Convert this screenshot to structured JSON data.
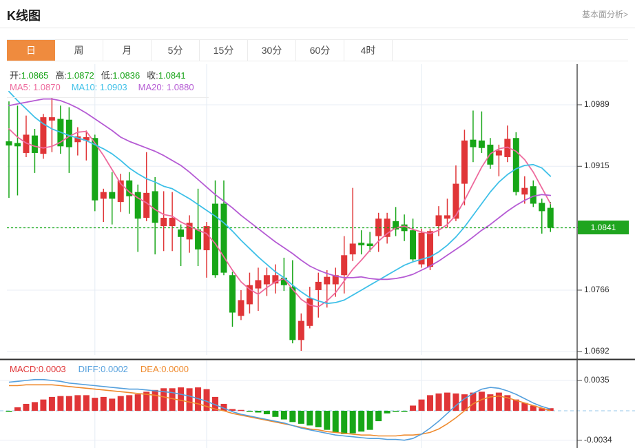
{
  "header": {
    "title": "K线图",
    "link": "基本面分析>"
  },
  "tabs": {
    "items": [
      "日",
      "周",
      "月",
      "5分",
      "15分",
      "30分",
      "60分",
      "4时"
    ],
    "active": "日"
  },
  "info": {
    "ohlc": [
      {
        "label": "开:",
        "value": "1.0865"
      },
      {
        "label": "高:",
        "value": "1.0872"
      },
      {
        "label": "低:",
        "value": "1.0836"
      },
      {
        "label": "收:",
        "value": "1.0841"
      }
    ],
    "ma_labels": [
      {
        "text": "MA5: 1.0870",
        "color": "#ee6a9d"
      },
      {
        "text": "MA10: 1.0903",
        "color": "#3ec0e8"
      },
      {
        "text": "MA20: 1.0880",
        "color": "#b55bd4"
      }
    ]
  },
  "colors": {
    "up": "#e03537",
    "down": "#17a617",
    "value_green": "#17a317",
    "ma5": "#ee6a9d",
    "ma10": "#3ec0e8",
    "ma20": "#b55bd4",
    "diff_blue": "#55a0dd",
    "dea_orange": "#ef8a2d",
    "tab_orange": "#ef8b3e",
    "grid": "#e9eef5",
    "axis": "#444444",
    "zero_dash": "#abd2ee",
    "current_line": "#0ea50e",
    "badge_bg": "#1fa51f"
  },
  "chart_data": {
    "type": "candlestick",
    "title": "K线图 (日)",
    "price_ticks": [
      1.0989,
      1.0915,
      1.0841,
      1.0766,
      1.0692
    ],
    "current_price_label": "1.0841",
    "current_price": 1.0841,
    "grid_x_candles": [
      11,
      24,
      49
    ],
    "candles_ohlc": [
      [
        1.0945,
        1.0993,
        1.0877,
        1.094
      ],
      [
        1.0943,
        1.0988,
        1.088,
        1.0939
      ],
      [
        1.0931,
        1.0976,
        1.0926,
        1.0953
      ],
      [
        1.0952,
        1.096,
        1.0907,
        1.0931
      ],
      [
        1.093,
        1.0978,
        1.0924,
        1.0974
      ],
      [
        1.097,
        1.0998,
        1.0932,
        1.0974
      ],
      [
        1.0972,
        1.0988,
        1.093,
        1.0939
      ],
      [
        1.0971,
        1.0986,
        1.0907,
        1.0938
      ],
      [
        1.0944,
        1.0962,
        1.0928,
        1.0951
      ],
      [
        1.0946,
        1.0958,
        1.0922,
        1.095
      ],
      [
        1.0949,
        1.0953,
        1.0861,
        1.0874
      ],
      [
        1.0876,
        1.0888,
        1.0848,
        1.0884
      ],
      [
        1.0884,
        1.0908,
        1.0845,
        1.0876
      ],
      [
        1.0872,
        1.0906,
        1.086,
        1.0898
      ],
      [
        1.0898,
        1.0908,
        1.0858,
        1.0879
      ],
      [
        1.0884,
        1.0893,
        1.0812,
        1.0852
      ],
      [
        1.0853,
        1.0932,
        1.0849,
        1.0883
      ],
      [
        1.0885,
        1.0902,
        1.0809,
        1.0847
      ],
      [
        1.0843,
        1.0885,
        1.0813,
        1.0853
      ],
      [
        1.0843,
        1.0884,
        1.0813,
        1.0853
      ],
      [
        1.0839,
        1.0845,
        1.0795,
        1.083
      ],
      [
        1.0827,
        1.0856,
        1.0811,
        1.0847
      ],
      [
        1.0839,
        1.0888,
        1.0795,
        1.0815
      ],
      [
        1.0814,
        1.0848,
        1.0781,
        1.0843
      ],
      [
        1.087,
        1.0898,
        1.0781,
        1.0784
      ],
      [
        1.087,
        1.0898,
        1.0784,
        1.0787
      ],
      [
        1.0784,
        1.0788,
        1.0722,
        1.0739
      ],
      [
        1.0735,
        1.0766,
        1.073,
        1.0754
      ],
      [
        1.0749,
        1.0787,
        1.0738,
        1.0772
      ],
      [
        1.0768,
        1.0793,
        1.0741,
        1.0778
      ],
      [
        1.0773,
        1.0793,
        1.0759,
        1.0784
      ],
      [
        1.0774,
        1.0797,
        1.0762,
        1.0784
      ],
      [
        1.0781,
        1.0805,
        1.0765,
        1.0772
      ],
      [
        1.077,
        1.0802,
        1.0702,
        1.0706
      ],
      [
        1.0706,
        1.0738,
        1.0693,
        1.0729
      ],
      [
        1.0723,
        1.077,
        1.072,
        1.0756
      ],
      [
        1.0766,
        1.0787,
        1.0733,
        1.0776
      ],
      [
        1.0773,
        1.079,
        1.0745,
        1.0782
      ],
      [
        1.0773,
        1.0793,
        1.0758,
        1.0784
      ],
      [
        1.0784,
        1.0831,
        1.0762,
        1.0808
      ],
      [
        1.0809,
        1.0889,
        1.0801,
        1.0822
      ],
      [
        1.0823,
        1.0838,
        1.0809,
        1.082
      ],
      [
        1.0822,
        1.0836,
        1.0812,
        1.0819
      ],
      [
        1.0831,
        1.0859,
        1.0812,
        1.0852
      ],
      [
        1.083,
        1.0859,
        1.0822,
        1.0852
      ],
      [
        1.0849,
        1.0866,
        1.0831,
        1.0839
      ],
      [
        1.0845,
        1.0857,
        1.0825,
        1.0837
      ],
      [
        1.0838,
        1.0852,
        1.0801,
        1.0803
      ],
      [
        1.0797,
        1.084,
        1.0793,
        1.0835
      ],
      [
        1.0794,
        1.084,
        1.079,
        1.0837
      ],
      [
        1.0843,
        1.0867,
        1.0831,
        1.0856
      ],
      [
        1.0852,
        1.0876,
        1.0841,
        1.0856
      ],
      [
        1.0852,
        1.0916,
        1.0849,
        1.0894
      ],
      [
        1.0894,
        1.0959,
        1.0868,
        1.0946
      ],
      [
        1.0947,
        1.0982,
        1.092,
        1.0938
      ],
      [
        1.0946,
        1.0981,
        1.0931,
        1.0937
      ],
      [
        1.0941,
        1.0949,
        1.0912,
        1.0917
      ],
      [
        1.0928,
        1.0941,
        1.0903,
        1.0934
      ],
      [
        1.0926,
        1.0964,
        1.092,
        1.0948
      ],
      [
        1.0949,
        1.0956,
        1.088,
        1.0884
      ],
      [
        1.0881,
        1.0903,
        1.087,
        1.0889
      ],
      [
        1.0891,
        1.0898,
        1.0866,
        1.087
      ],
      [
        1.0871,
        1.0876,
        1.0834,
        1.0861
      ],
      [
        1.0865,
        1.0872,
        1.0836,
        1.0841
      ]
    ],
    "ma5": [
      1.096,
      1.095,
      1.0943,
      1.0939,
      1.0937,
      1.0939,
      1.0944,
      1.0951,
      1.0956,
      1.0957,
      1.0943,
      1.0928,
      1.0911,
      1.0894,
      1.0884,
      1.0877,
      1.0871,
      1.0863,
      1.0857,
      1.0855,
      1.0848,
      1.0843,
      1.0838,
      1.0834,
      1.0822,
      1.0806,
      1.079,
      1.0776,
      1.0767,
      1.0761,
      1.0769,
      1.0776,
      1.078,
      1.0767,
      1.0755,
      1.0748,
      1.0746,
      1.0753,
      1.0763,
      1.0777,
      1.0791,
      1.0802,
      1.0814,
      1.0825,
      1.0834,
      1.0841,
      1.0843,
      1.0839,
      1.0836,
      1.0834,
      1.0838,
      1.0845,
      1.0856,
      1.0874,
      1.0894,
      1.0914,
      1.093,
      1.0936,
      1.0938,
      1.0933,
      1.0923,
      1.0908,
      1.0889,
      1.087
    ],
    "ma10": [
      1.1005,
      1.0994,
      1.0984,
      1.0974,
      1.0966,
      1.096,
      1.0956,
      1.0952,
      1.0949,
      1.0946,
      1.0941,
      1.0936,
      1.093,
      1.0922,
      1.0913,
      1.0906,
      1.09,
      1.0896,
      1.0891,
      1.0888,
      1.0882,
      1.0876,
      1.0869,
      1.0862,
      1.0855,
      1.0847,
      1.0837,
      1.0826,
      1.0816,
      1.0806,
      1.0797,
      1.0788,
      1.0781,
      1.0772,
      1.0764,
      1.0757,
      1.0753,
      1.075,
      1.0751,
      1.0754,
      1.076,
      1.0766,
      1.0772,
      1.0778,
      1.0784,
      1.079,
      1.0796,
      1.08,
      1.0803,
      1.0806,
      1.0812,
      1.082,
      1.083,
      1.0842,
      1.0856,
      1.087,
      1.0884,
      1.0896,
      1.0905,
      1.0912,
      1.0916,
      1.0917,
      1.0913,
      1.0903
    ],
    "ma20": [
      1.0988,
      1.099,
      1.0992,
      1.0994,
      1.0996,
      1.0996,
      1.0994,
      1.099,
      1.0985,
      1.0979,
      1.0972,
      1.0965,
      1.0958,
      1.095,
      1.0945,
      1.0941,
      1.0937,
      1.0933,
      1.0928,
      1.0922,
      1.0916,
      1.0908,
      1.0899,
      1.089,
      1.0881,
      1.0873,
      1.0865,
      1.0856,
      1.0848,
      1.084,
      1.0832,
      1.0824,
      1.0817,
      1.081,
      1.0802,
      1.0795,
      1.079,
      1.0786,
      1.0783,
      1.0781,
      1.0781,
      1.0782,
      1.078,
      1.0779,
      1.0779,
      1.078,
      1.0782,
      1.0785,
      1.079,
      1.0795,
      1.0801,
      1.0808,
      1.0815,
      1.0822,
      1.083,
      1.0838,
      1.0845,
      1.0853,
      1.0861,
      1.0868,
      1.0874,
      1.0879,
      1.0881,
      1.088
    ],
    "macd": {
      "labels": [
        {
          "text": "MACD:0.0003",
          "color": "#e03537"
        },
        {
          "text": "DIFF:0.0002",
          "color": "#55a0dd"
        },
        {
          "text": "DEA:0.0000",
          "color": "#ef8a2d"
        }
      ],
      "ticks": [
        0.0035,
        -0.0034
      ],
      "hist": [
        -0.0001,
        0.0004,
        0.0008,
        0.001,
        0.0013,
        0.0016,
        0.0017,
        0.0017,
        0.0018,
        0.0018,
        0.0015,
        0.0016,
        0.0014,
        0.0017,
        0.0018,
        0.0019,
        0.0022,
        0.0024,
        0.0026,
        0.0026,
        0.0027,
        0.0026,
        0.0027,
        0.0025,
        0.0016,
        0.0008,
        0.0002,
        0.0001,
        -0.0001,
        -0.0002,
        -0.0004,
        -0.0007,
        -0.001,
        -0.0013,
        -0.0015,
        -0.0017,
        -0.0019,
        -0.0022,
        -0.0025,
        -0.0027,
        -0.0026,
        -0.0024,
        -0.0022,
        -0.0012,
        -0.0003,
        -0.0001,
        -0.0001,
        0.0006,
        0.0013,
        0.0018,
        0.002,
        0.0021,
        0.002,
        0.0019,
        0.0021,
        0.0022,
        0.0019,
        0.0021,
        0.0018,
        0.0013,
        0.0009,
        0.0006,
        0.0003,
        0.0003
      ],
      "diff": [
        0.0033,
        0.0034,
        0.0035,
        0.0036,
        0.0036,
        0.0035,
        0.0034,
        0.0032,
        0.0031,
        0.003,
        0.0029,
        0.0028,
        0.0027,
        0.0026,
        0.0025,
        0.0025,
        0.0024,
        0.0023,
        0.0022,
        0.0021,
        0.0019,
        0.0017,
        0.0014,
        0.0011,
        0.0007,
        0.0003,
        -0.0001,
        -0.0004,
        -0.0006,
        -0.0008,
        -0.001,
        -0.0012,
        -0.0014,
        -0.0017,
        -0.002,
        -0.0022,
        -0.0024,
        -0.0026,
        -0.0028,
        -0.0029,
        -0.003,
        -0.0031,
        -0.0032,
        -0.0032,
        -0.0033,
        -0.0033,
        -0.0034,
        -0.0032,
        -0.0027,
        -0.002,
        -0.0012,
        -0.0003,
        0.0006,
        0.0014,
        0.002,
        0.0025,
        0.0027,
        0.0026,
        0.0023,
        0.0019,
        0.0014,
        0.0009,
        0.0005,
        0.0002
      ],
      "dea": [
        0.0029,
        0.0029,
        0.003,
        0.003,
        0.003,
        0.003,
        0.0029,
        0.0028,
        0.0027,
        0.0026,
        0.0025,
        0.0024,
        0.0023,
        0.0022,
        0.0021,
        0.002,
        0.0019,
        0.0018,
        0.0016,
        0.0014,
        0.0012,
        0.001,
        0.0008,
        0.0005,
        0.0002,
        0.0,
        -0.0003,
        -0.0005,
        -0.0007,
        -0.0009,
        -0.0011,
        -0.0013,
        -0.0015,
        -0.0017,
        -0.0019,
        -0.0021,
        -0.0022,
        -0.0024,
        -0.0025,
        -0.0026,
        -0.0027,
        -0.0028,
        -0.0028,
        -0.0029,
        -0.0029,
        -0.0029,
        -0.0028,
        -0.0028,
        -0.0027,
        -0.0025,
        -0.0021,
        -0.0015,
        -0.0008,
        0.0,
        0.0008,
        0.0013,
        0.0016,
        0.0017,
        0.0015,
        0.0012,
        0.0009,
        0.0006,
        0.0003,
        0.0
      ]
    }
  }
}
